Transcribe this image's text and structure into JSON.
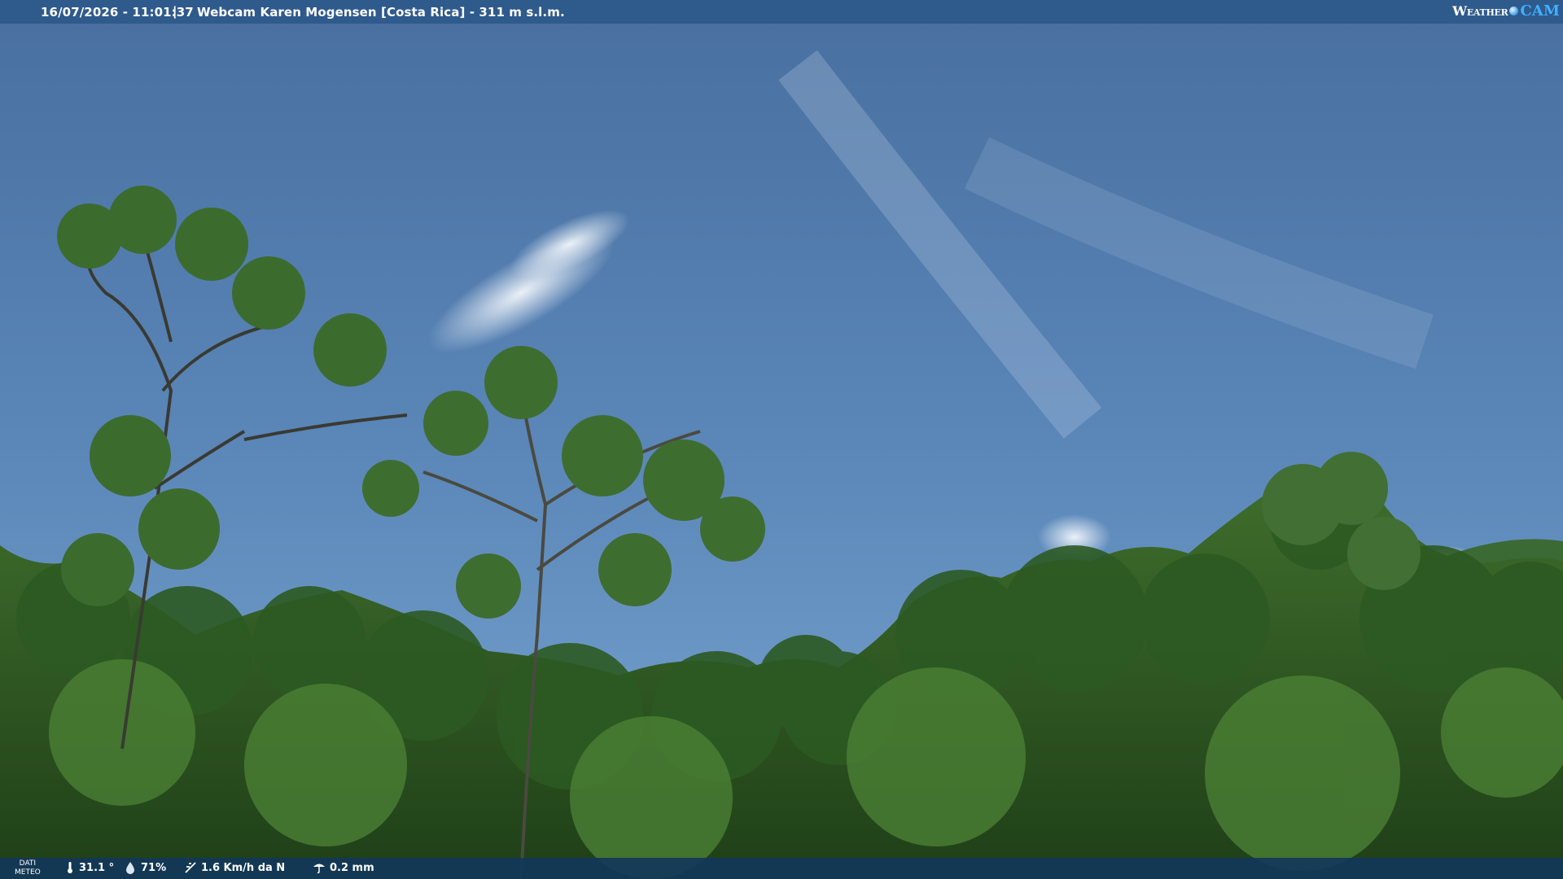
{
  "header": {
    "datetime": "16/07/2026 - 11:01:37",
    "separator": "|",
    "title": "Webcam Karen Mogensen [Costa Rica] - 311 m s.l.m.",
    "logo_weather": "Weather",
    "logo_cam": "CAM"
  },
  "footer": {
    "label_line1": "DATI",
    "label_line2": "METEO",
    "temperature": "31.1 °",
    "humidity": "71%",
    "wind": "1.6 Km/h da N",
    "rain": "0.2 mm",
    "icons": [
      "thermometer-icon",
      "humidity-icon",
      "wind-icon",
      "rain-icon"
    ]
  },
  "colors": {
    "sky_top": "#4a73a6",
    "sky_bottom": "#6f9ccc",
    "foliage": "#2f5a24",
    "topbar": "#2f5a8c",
    "bottombar": "#12375a"
  }
}
